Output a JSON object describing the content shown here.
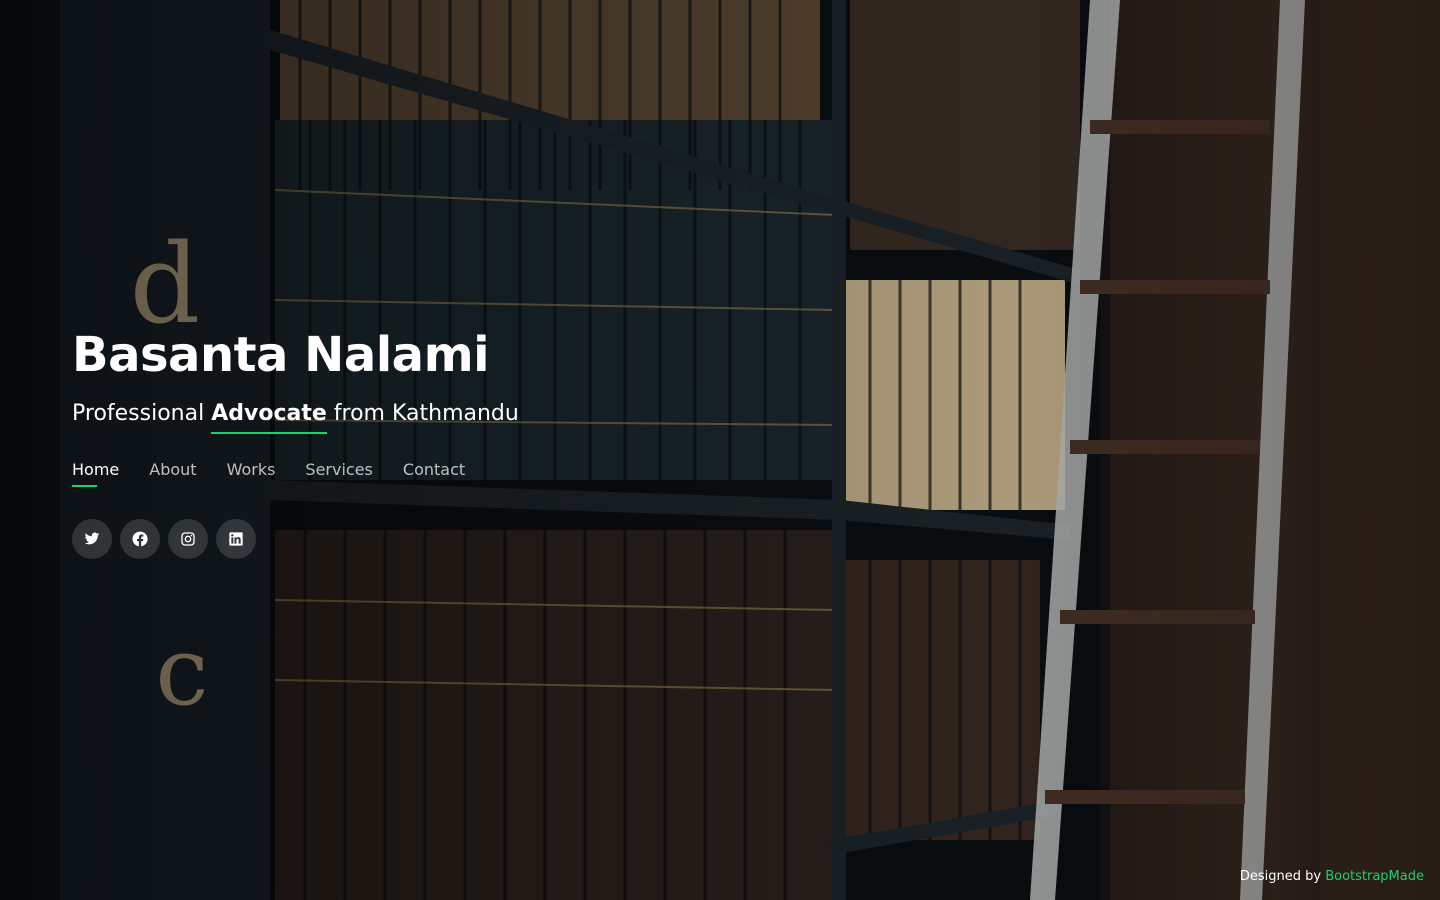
{
  "hero": {
    "name": "Basanta Nalami",
    "tagline_prefix": "Professional",
    "tagline_highlight": "Advocate",
    "tagline_suffix": "from Kathmandu"
  },
  "nav": {
    "items": [
      {
        "label": "Home",
        "active": true
      },
      {
        "label": "About",
        "active": false
      },
      {
        "label": "Works",
        "active": false
      },
      {
        "label": "Services",
        "active": false
      },
      {
        "label": "Contact",
        "active": false
      }
    ]
  },
  "social": {
    "icons": [
      "twitter-icon",
      "facebook-icon",
      "instagram-icon",
      "linkedin-icon"
    ]
  },
  "credits": {
    "prefix": "Designed by",
    "link_label": "BootstrapMade"
  },
  "colors": {
    "accent": "#18d26e",
    "text": "#ffffff",
    "background": "#101418"
  }
}
